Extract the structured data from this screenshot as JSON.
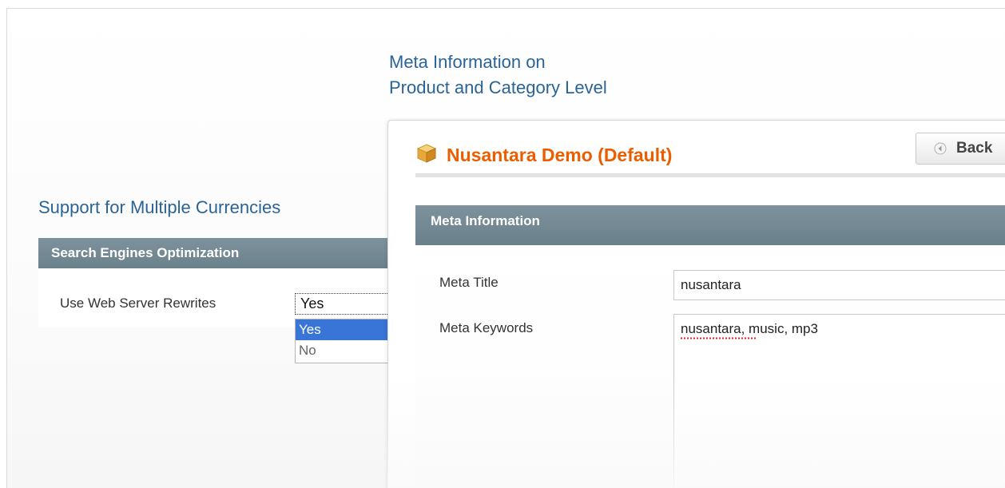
{
  "captions": {
    "meta_info_line1": "Meta Information on",
    "meta_info_line2": "Product and Category Level",
    "multiple_currencies": "Support for Multiple Currencies"
  },
  "seo_panel": {
    "header": "Search Engines Optimization",
    "field_label": "Use Web Server Rewrites",
    "selected_value": "Yes",
    "options": [
      "Yes",
      "No"
    ],
    "highlighted_option": "Yes"
  },
  "store_panel": {
    "store_title": "Nusantara Demo (Default)",
    "back_label": "Back",
    "section_header": "Meta Information",
    "fields": {
      "meta_title_label": "Meta Title",
      "meta_title_value": "nusantara",
      "meta_keywords_label": "Meta Keywords",
      "meta_keywords_value": "nusantara, music, mp3"
    }
  },
  "colors": {
    "caption_blue": "#2a6496",
    "store_title_orange": "#eb5e00",
    "section_header_gray": "#738892",
    "selection_blue": "#3875d7"
  },
  "icons": {
    "store": "store-box-icon",
    "back": "circle-arrow-left-icon"
  }
}
